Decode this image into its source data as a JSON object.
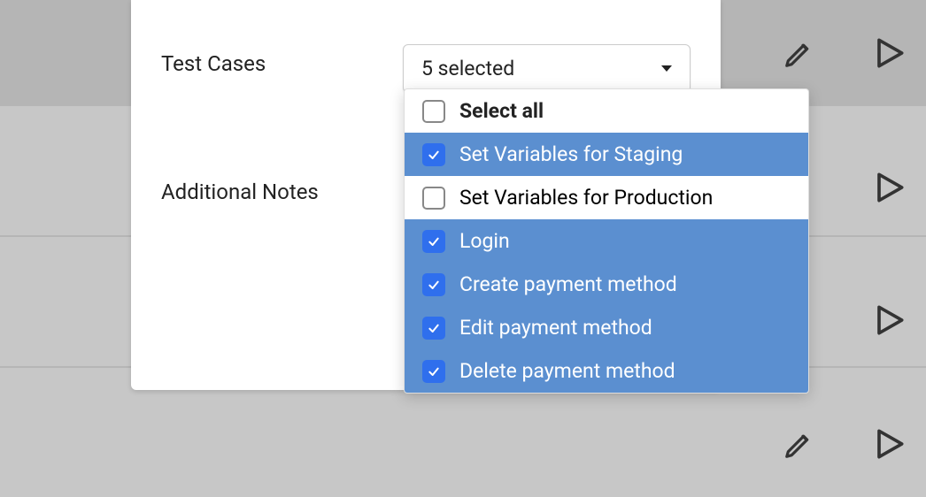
{
  "form": {
    "test_cases_label": "Test Cases",
    "additional_notes_label": "Additional Notes",
    "select_summary": "5 selected"
  },
  "dropdown": {
    "select_all_label": "Select all",
    "select_all_checked": false,
    "items": [
      {
        "label": "Set Variables for Staging",
        "checked": true
      },
      {
        "label": "Set Variables for Production",
        "checked": false
      },
      {
        "label": "Login",
        "checked": true
      },
      {
        "label": "Create payment method",
        "checked": true
      },
      {
        "label": "Edit payment method",
        "checked": true
      },
      {
        "label": "Delete payment method",
        "checked": true
      }
    ]
  },
  "colors": {
    "accent": "#2f6fed",
    "row_selected": "#5b8fd0",
    "backdrop": "#b5b5b5"
  }
}
